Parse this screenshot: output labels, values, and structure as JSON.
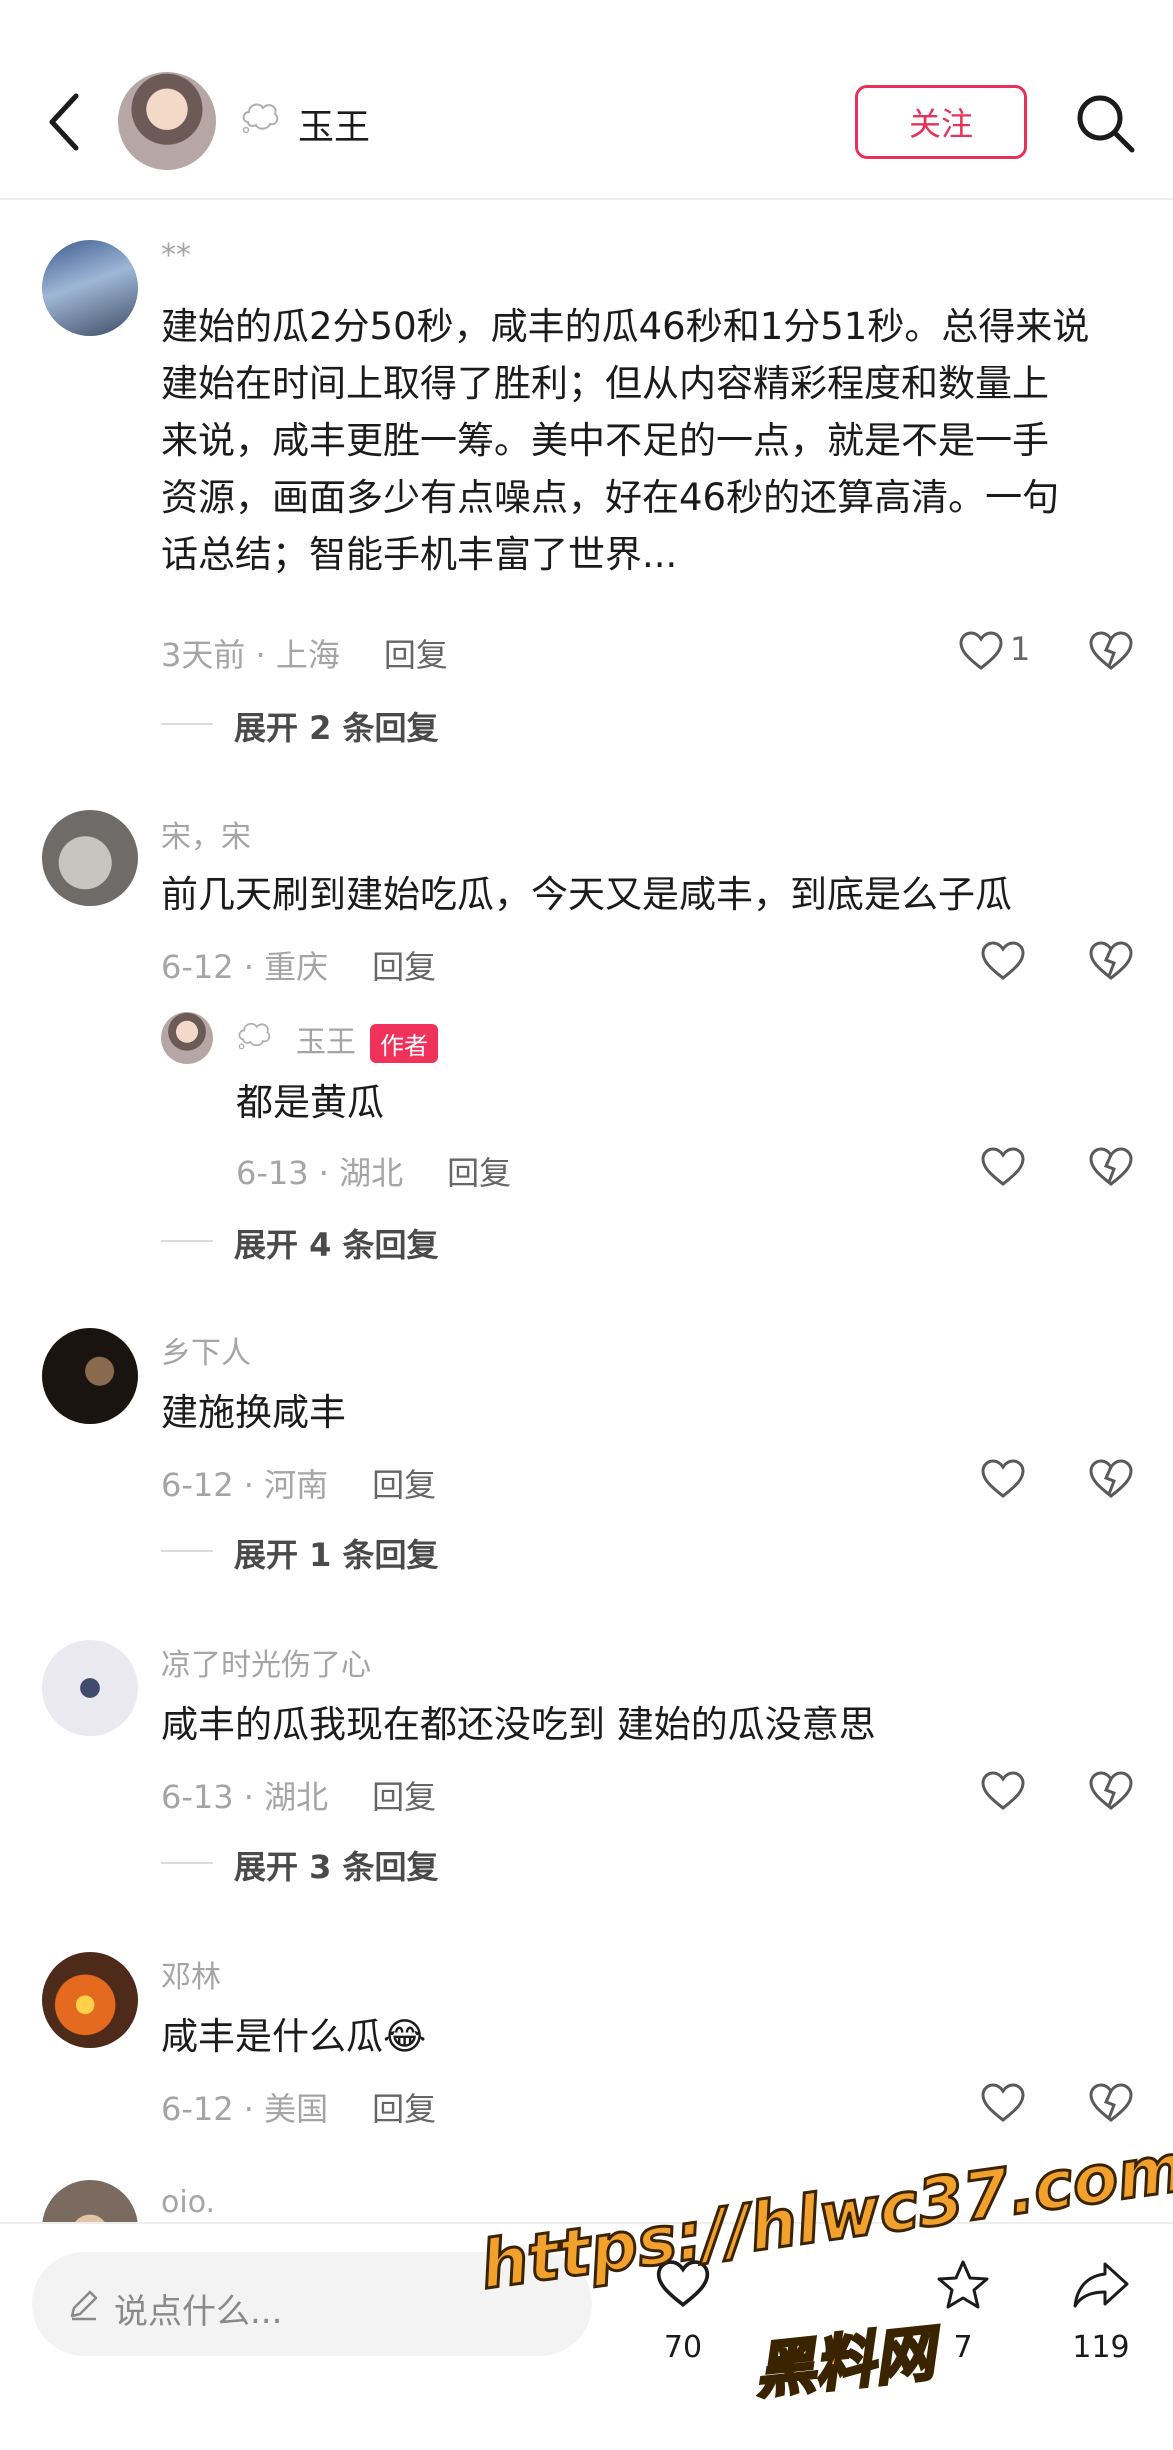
{
  "header": {
    "back_icon": "chevron-left-icon",
    "username": "玉王",
    "follow_label": "关注",
    "search_icon": "search-icon"
  },
  "comments": [
    {
      "username": "**",
      "text_lines": [
        "建始的瓜2分50秒，咸丰的瓜46秒和1分51秒。总得来说",
        "建始在时间上取得了胜利；但从内容精彩程度和数量上",
        "来说，咸丰更胜一筹。美中不足的一点，就是不是一手",
        "资源，画面多少有点噪点，好在46秒的还算高清。一句",
        "话总结；智能手机丰富了世界..."
      ],
      "meta": "3天前 · 上海",
      "reply_label": "回复",
      "likes": "1",
      "expand": "展开 2 条回复"
    },
    {
      "username": "宋，宋",
      "text": "前几天刷到建始吃瓜，今天又是咸丰，到底是么子瓜",
      "meta": "6-12 · 重庆",
      "reply_label": "回复",
      "likes": "",
      "sub_reply": {
        "username": "玉王",
        "badge": "作者",
        "text": "都是黄瓜",
        "meta": "6-13 · 湖北",
        "reply_label": "回复"
      },
      "expand": "展开 4 条回复"
    },
    {
      "username": "乡下人",
      "text": "建施换咸丰",
      "meta": "6-12 · 河南",
      "reply_label": "回复",
      "likes": "",
      "expand": "展开 1 条回复"
    },
    {
      "username": "凉了时光伤了心",
      "text": "咸丰的瓜我现在都还没吃到 建始的瓜没意思",
      "meta": "6-13 · 湖北",
      "reply_label": "回复",
      "likes": "",
      "expand": "展开 3 条回复"
    },
    {
      "username": "邓林",
      "text": "咸丰是什么瓜😂",
      "meta": "6-12 · 美国",
      "reply_label": "回复",
      "likes": ""
    },
    {
      "username": "oio."
    }
  ],
  "bottom_bar": {
    "input_placeholder": "说点什么...",
    "like_count": "70",
    "star_count": "7",
    "share_count": "119"
  },
  "watermark": {
    "line1": "https://hlwc37.com",
    "line2": "黑料网"
  },
  "colors": {
    "accent": "#e6325a",
    "muted_text": "#a5a5a5"
  }
}
